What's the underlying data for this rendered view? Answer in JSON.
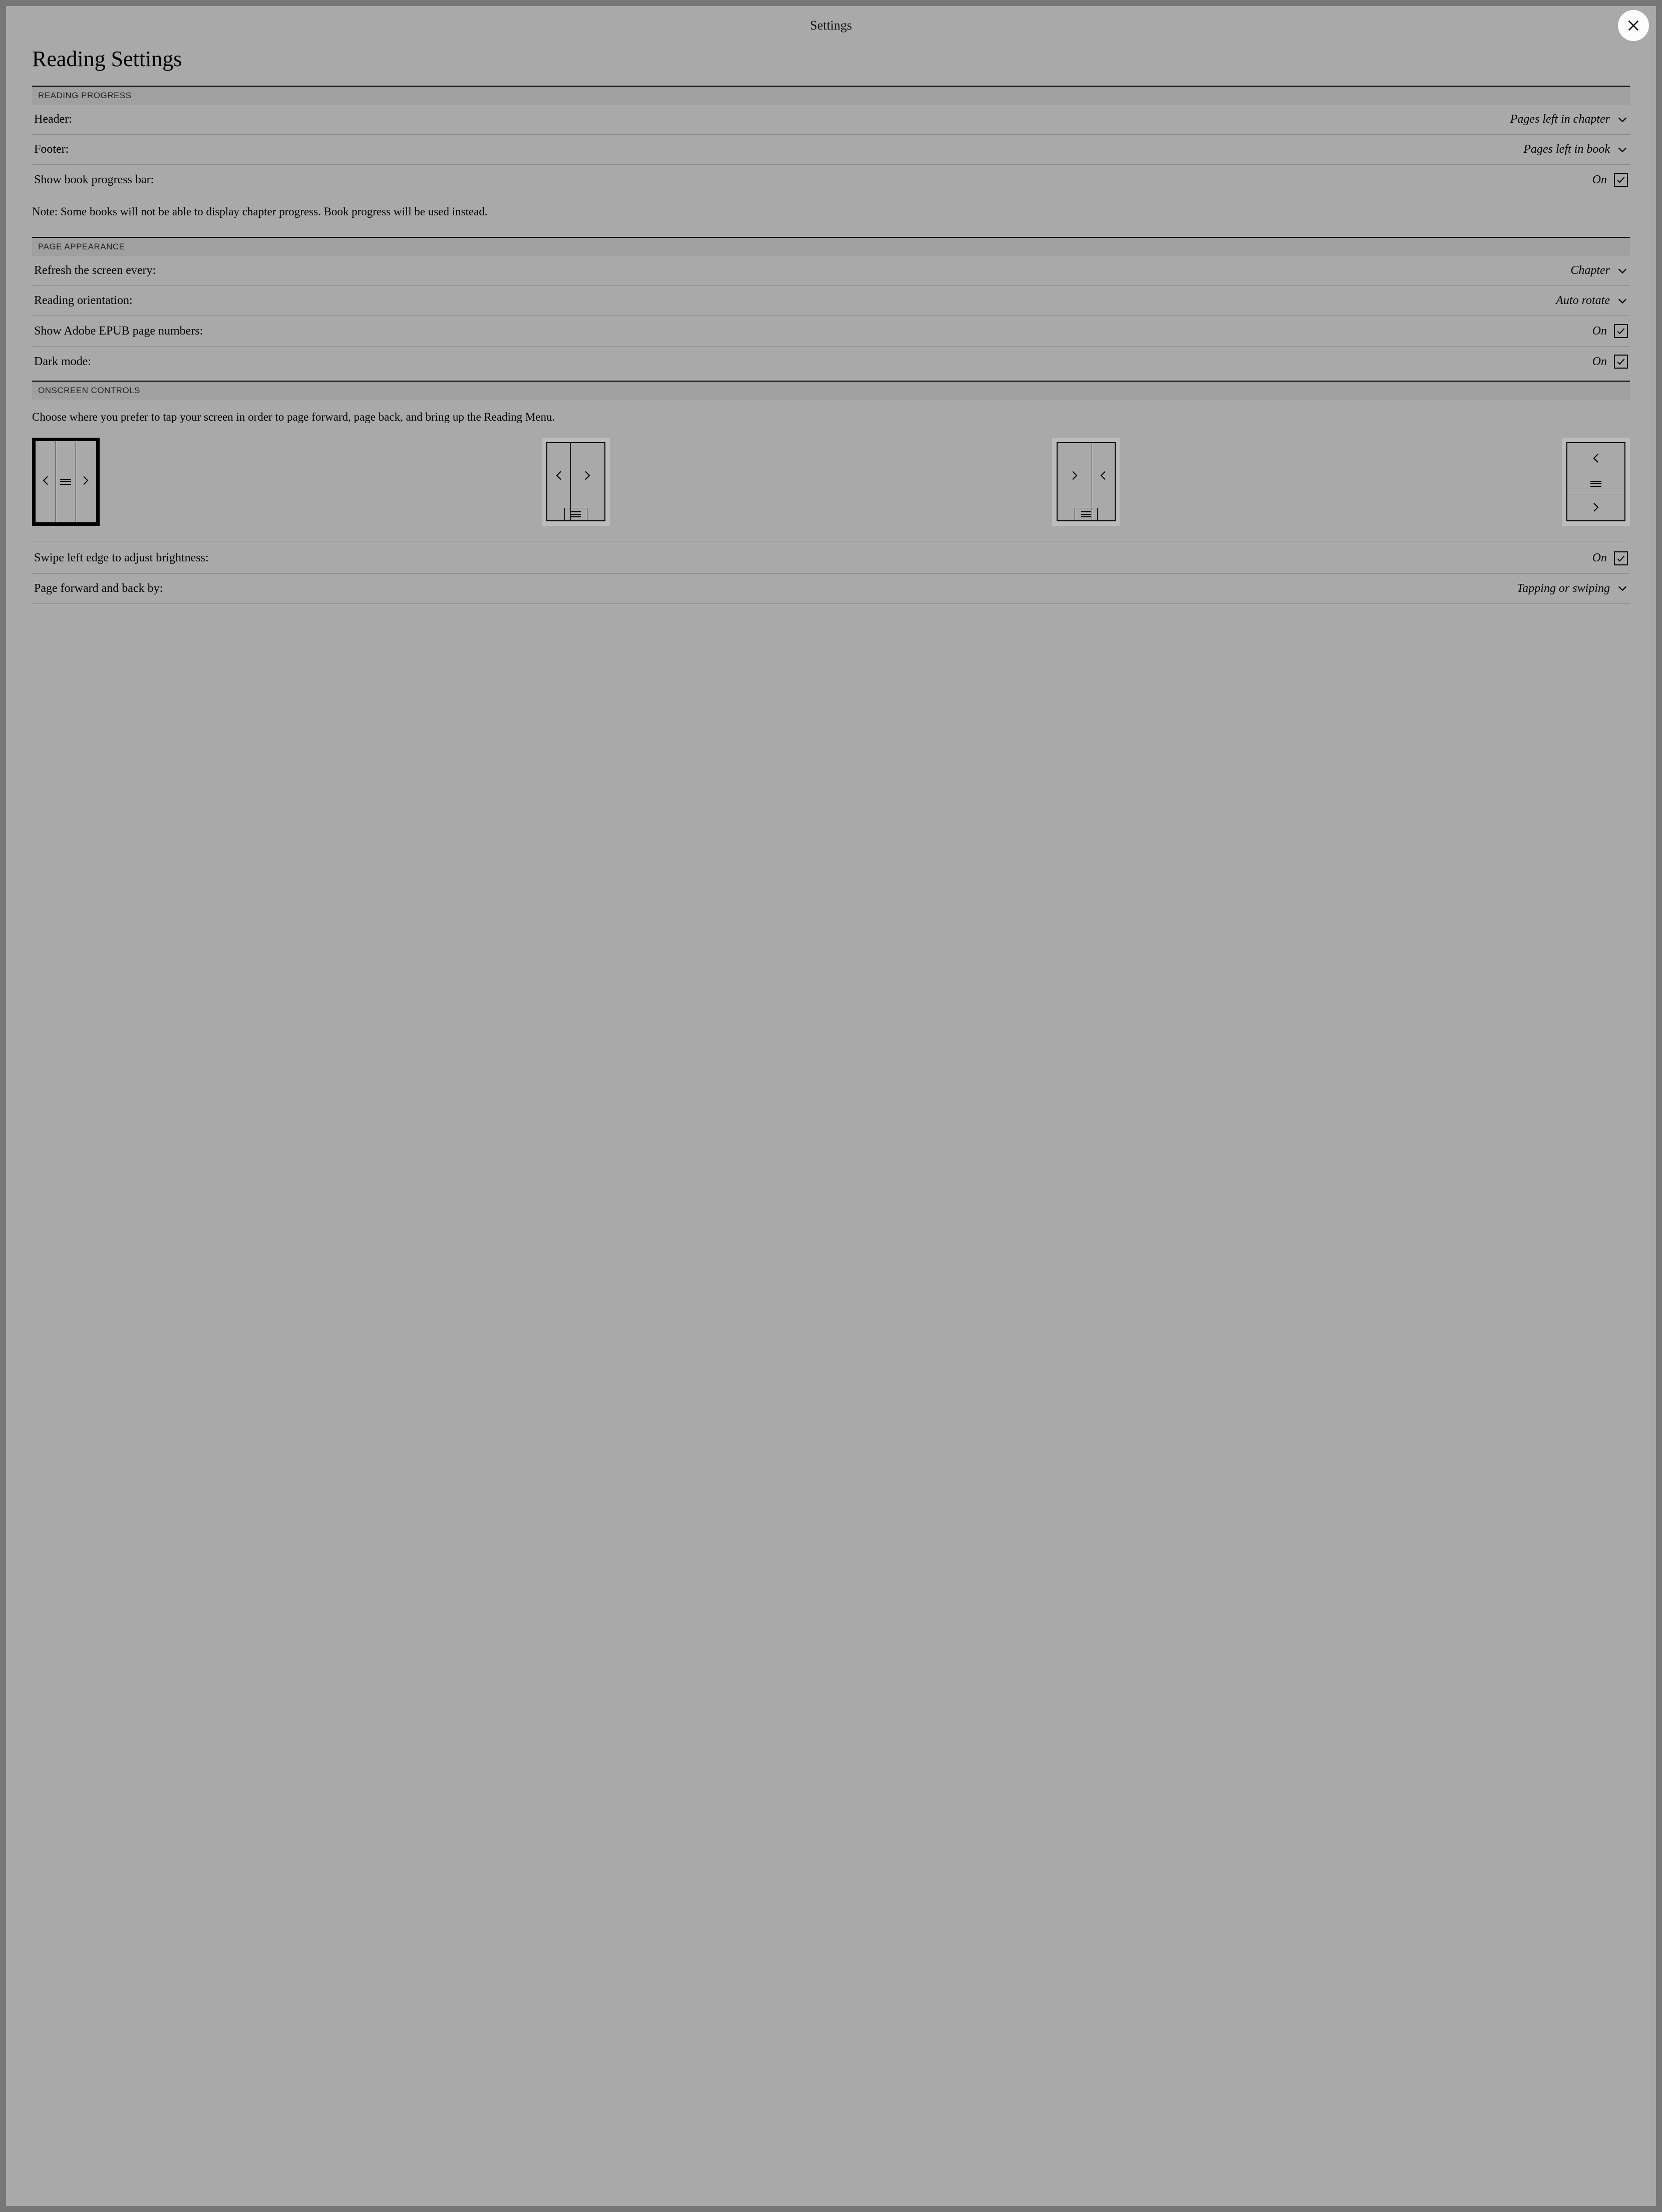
{
  "topbar": {
    "title": "Settings"
  },
  "page_title": "Reading Settings",
  "sections": {
    "reading_progress": {
      "header": "READING PROGRESS",
      "rows": {
        "header_row": {
          "label": "Header:",
          "value": "Pages left in chapter"
        },
        "footer_row": {
          "label": "Footer:",
          "value": "Pages left in book"
        },
        "progress_bar": {
          "label": "Show book progress bar:",
          "value": "On",
          "checked": true
        }
      },
      "note": "Note: Some books will not be able to display chapter progress. Book progress will be used instead."
    },
    "page_appearance": {
      "header": "PAGE APPEARANCE",
      "rows": {
        "refresh": {
          "label": "Refresh the screen every:",
          "value": "Chapter"
        },
        "orientation": {
          "label": "Reading orientation:",
          "value": "Auto rotate"
        },
        "adobe_page_numbers": {
          "label": "Show Adobe EPUB page numbers:",
          "value": "On",
          "checked": true
        },
        "dark_mode": {
          "label": "Dark mode:",
          "value": "On",
          "checked": true
        }
      }
    },
    "onscreen_controls": {
      "header": "ONSCREEN CONTROLS",
      "description": "Choose where you prefer to tap your screen in order to page forward, page back, and bring up the Reading Menu.",
      "selected_layout_index": 0,
      "rows": {
        "swipe_brightness": {
          "label": "Swipe left edge to adjust brightness:",
          "value": "On",
          "checked": true
        },
        "page_turn": {
          "label": "Page forward and back by:",
          "value": "Tapping or swiping"
        }
      }
    }
  }
}
